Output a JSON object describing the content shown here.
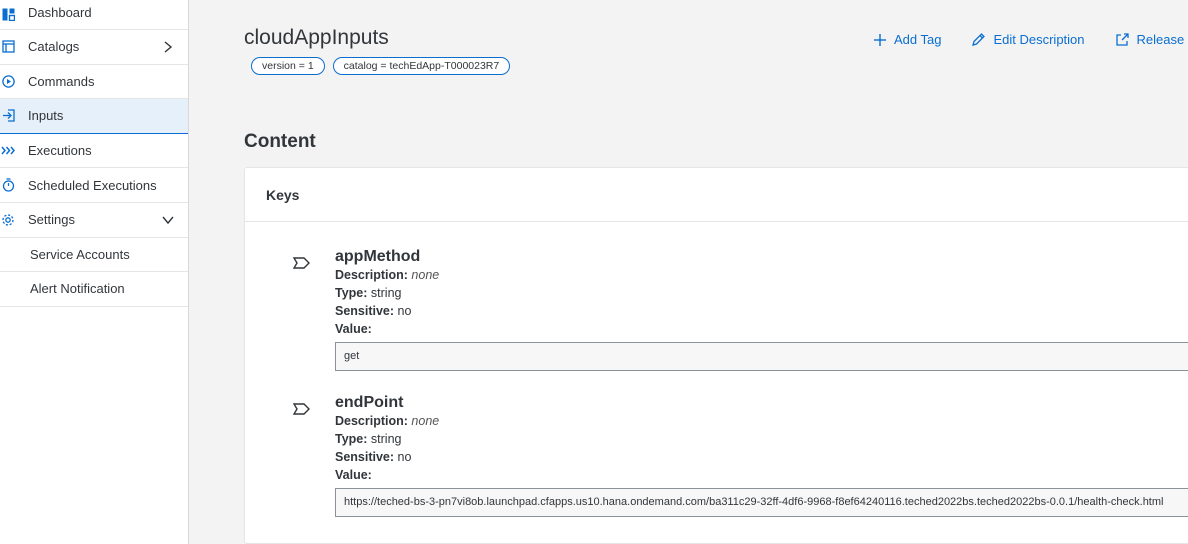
{
  "sidebar": {
    "items": [
      {
        "label": "Dashboard",
        "icon": "dashboard-icon"
      },
      {
        "label": "Catalogs",
        "icon": "catalog-icon",
        "chevron": "right"
      },
      {
        "label": "Commands",
        "icon": "command-icon"
      },
      {
        "label": "Inputs",
        "icon": "input-icon",
        "active": true
      },
      {
        "label": "Executions",
        "icon": "executions-icon"
      },
      {
        "label": "Scheduled Executions",
        "icon": "timer-icon"
      },
      {
        "label": "Settings",
        "icon": "gear-icon",
        "chevron": "down"
      },
      {
        "label": "Service Accounts",
        "sub": true
      },
      {
        "label": "Alert Notification",
        "sub": true
      }
    ]
  },
  "header": {
    "title": "cloudAppInputs",
    "tags": [
      "version = 1",
      "catalog = techEdApp-T000023R7"
    ],
    "actions": {
      "add_tag": "Add Tag",
      "edit_description": "Edit Description",
      "release": "Release"
    }
  },
  "content": {
    "section_title": "Content",
    "panel_title": "Keys",
    "labels": {
      "description": "Description:",
      "type": "Type:",
      "sensitive": "Sensitive:",
      "value": "Value:"
    },
    "keys": [
      {
        "name": "appMethod",
        "description": "none",
        "type": "string",
        "sensitive": "no",
        "value": "get"
      },
      {
        "name": "endPoint",
        "description": "none",
        "type": "string",
        "sensitive": "no",
        "value": "https://teched-bs-3-pn7vi8ob.launchpad.cfapps.us10.hana.ondemand.com/ba311c29-32ff-4df6-9968-f8ef64240116.teched2022bs.teched2022bs-0.0.1/health-check.html"
      }
    ]
  },
  "colors": {
    "accent": "#0a6ed1",
    "active_bg": "#e5f0fa",
    "page_bg": "#f3f3f3"
  }
}
